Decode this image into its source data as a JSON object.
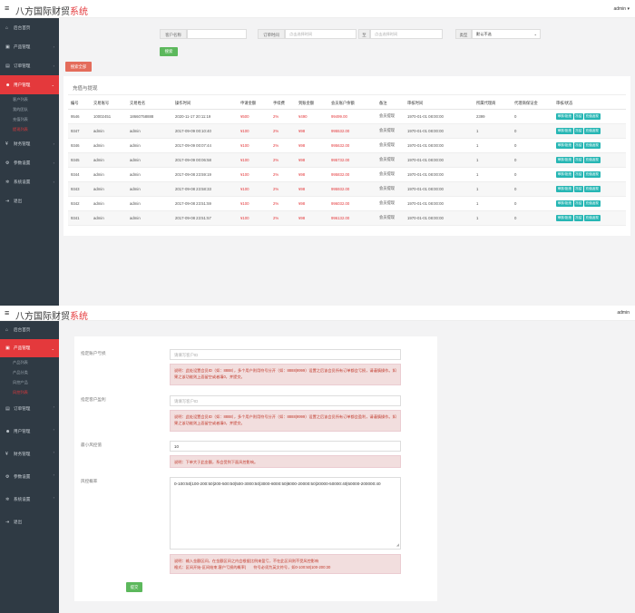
{
  "app": {
    "brand_main": "八方国际财贸",
    "brand_accent": "系统",
    "admin": "admin"
  },
  "colors": {
    "accent": "#e4393c",
    "sidebar": "#2f3a44",
    "success": "#5cb85c",
    "teal": "#26b6b4",
    "danger_bg": "#f2dede"
  },
  "screen1": {
    "nav": [
      {
        "label": "后台首页",
        "icon": "home-icon"
      },
      {
        "label": "产品管理",
        "icon": "box-icon"
      },
      {
        "label": "订单管理",
        "icon": "order-icon"
      },
      {
        "label": "用户管理",
        "icon": "user-icon"
      },
      {
        "label": "财务管理",
        "icon": "finance-icon"
      },
      {
        "label": "参数设置",
        "icon": "gear-icon"
      },
      {
        "label": "系统设置",
        "icon": "system-icon"
      },
      {
        "label": "退出",
        "icon": "logout-icon"
      }
    ],
    "user_subs": [
      "客户列表",
      "我的团队",
      "充值列表",
      "提现列表"
    ],
    "filters": {
      "account_label": "客户名称",
      "order_time_label": "订单时间",
      "start_placeholder": "点击选择时间",
      "to_label": "至",
      "end_placeholder": "点击选择时间",
      "type_label": "类型",
      "type_value": "默认不选",
      "search_button": "搜索",
      "bulk_button": "搜索全部"
    },
    "section_title": "充值与提现",
    "table": {
      "headers": [
        "编号",
        "交易账号",
        "交易姓名",
        "操作时间",
        "申请金额",
        "手续费",
        "到账金额",
        "会员账户余额",
        "备注",
        "审核时间",
        "所属代理商",
        "代理商保证金",
        "审核/状态"
      ],
      "actions": [
        "审核/拒绝",
        "冻结",
        "充值返现"
      ],
      "rows": [
        [
          "9546",
          "10002451",
          "18660758888",
          "2020-11-17 20:11:19",
          "¥500",
          "2%",
          "¥490",
          "99499.00",
          "会员提现",
          "1970-01-01 08:00:00",
          "2399",
          "0"
        ],
        [
          "9347",
          "admin",
          "admin",
          "2017-09-09 00:10:40",
          "¥100",
          "2%",
          "¥98",
          "995532.00",
          "会员提现",
          "1970-01-01 08:00:00",
          "1",
          "0"
        ],
        [
          "9346",
          "admin",
          "admin",
          "2017-09-09 00:07:44",
          "¥100",
          "2%",
          "¥98",
          "995632.00",
          "会员提现",
          "1970-01-01 08:00:00",
          "1",
          "0"
        ],
        [
          "9345",
          "admin",
          "admin",
          "2017-09-09 00:06:58",
          "¥100",
          "2%",
          "¥98",
          "995732.00",
          "会员提现",
          "1970-01-01 08:00:00",
          "1",
          "0"
        ],
        [
          "9344",
          "admin",
          "admin",
          "2017-09-08 23:59:19",
          "¥100",
          "2%",
          "¥98",
          "995832.00",
          "会员提现",
          "1970-01-01 08:00:00",
          "1",
          "0"
        ],
        [
          "9343",
          "admin",
          "admin",
          "2017-09-08 23:58:33",
          "¥100",
          "2%",
          "¥98",
          "995932.00",
          "会员提现",
          "1970-01-01 08:00:00",
          "1",
          "0"
        ],
        [
          "9342",
          "admin",
          "admin",
          "2017-09-08 23:51:59",
          "¥100",
          "2%",
          "¥98",
          "996032.00",
          "会员提现",
          "1970-01-01 08:00:00",
          "1",
          "0"
        ],
        [
          "9341",
          "admin",
          "admin",
          "2017-09-08 23:51:57",
          "¥100",
          "2%",
          "¥98",
          "996132.00",
          "会员提现",
          "1970-01-01 08:00:00",
          "1",
          "0"
        ]
      ]
    }
  },
  "screen2": {
    "nav_top": [
      {
        "label": "后台首页",
        "icon": "home-icon"
      },
      {
        "label": "产品管理",
        "icon": "box-icon"
      }
    ],
    "product_subs": [
      "产品列表",
      "产品分类",
      "风控产品",
      "风控列表"
    ],
    "nav_rest": [
      {
        "label": "订单管理",
        "icon": "order-icon"
      },
      {
        "label": "用户管理",
        "icon": "user-icon"
      },
      {
        "label": "财务管理",
        "icon": "finance-icon"
      },
      {
        "label": "参数设置",
        "icon": "gear-icon"
      },
      {
        "label": "系统设置",
        "icon": "system-icon"
      },
      {
        "label": "退出",
        "icon": "logout-icon"
      }
    ],
    "form": {
      "designated_account_label": "指定账户亏损",
      "designated_account_placeholder": "请填写客户ID",
      "designated_account_hint": "说明：此处设置会员ID（如：8888），多个用户则用符号分开（如：8888|9999）设置之后该会员所有订单都会亏损，请谨慎操作。如果之该功能则上面留空或者填0，并提交。",
      "designated_profit_label": "指定客户盈利",
      "designated_profit_placeholder": "请填写客户ID",
      "designated_profit_hint": "说明：此处设置会员ID（如：8888），多个用户则用符号分开（如：8888|9999）设置之后该会员所有订单都会盈利，请谨慎操作。如果之该功能则上面留空或者填0，并提交。",
      "min_risk_label": "最小风控值",
      "min_risk_value": "10",
      "min_risk_hint": "说明：下单大于此金额，系会受到下面风控影响。",
      "risk_rate_label": "风控概率",
      "risk_rate_value": "0-100:50|100-200:50|200-500:50|500-3000:50|3000-8000:50|8000-20000:50|20000-50000:40|50000-200000:40",
      "risk_rate_hint_1": "说明：输入金额区间，在金额区间之内会根据比例来盈亏，不在此区间则不受风控影响",
      "risk_rate_hint_2": "格式：区间开始-区间结束:客户亏损的概率|　　符号必须为英文符号，如0-100:50|100-200:30",
      "submit_button": "提交"
    }
  }
}
